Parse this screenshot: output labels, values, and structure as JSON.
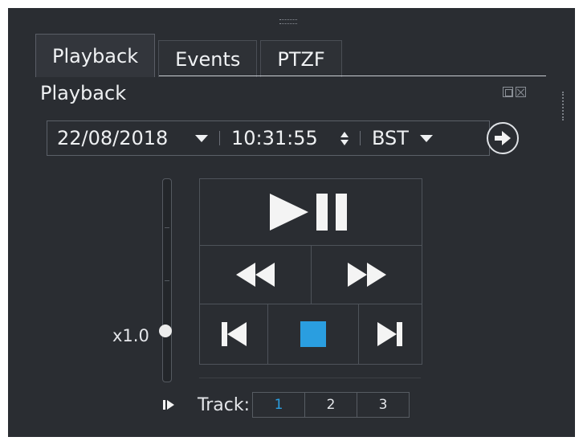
{
  "tabs": [
    {
      "label": "Playback",
      "active": true
    },
    {
      "label": "Events",
      "active": false
    },
    {
      "label": "PTZF",
      "active": false
    }
  ],
  "section": {
    "title": "Playback"
  },
  "datetime": {
    "date": "22/08/2018",
    "time": "10:31:55",
    "timezone": "BST"
  },
  "speed": {
    "label": "x1.0",
    "level_fraction": 0.12
  },
  "controls": {
    "play_pause": "play-pause-icon",
    "rewind": "rewind-icon",
    "fast_forward": "fast-forward-icon",
    "skip_start": "skip-to-start-icon",
    "stop": "stop-icon",
    "skip_end": "skip-to-end-icon"
  },
  "track": {
    "label": "Track:",
    "options": [
      "1",
      "2",
      "3"
    ],
    "selected": "1"
  },
  "colors": {
    "panel_bg": "#2a2d32",
    "accent": "#2a9ee0",
    "text": "#e4e6ea"
  }
}
